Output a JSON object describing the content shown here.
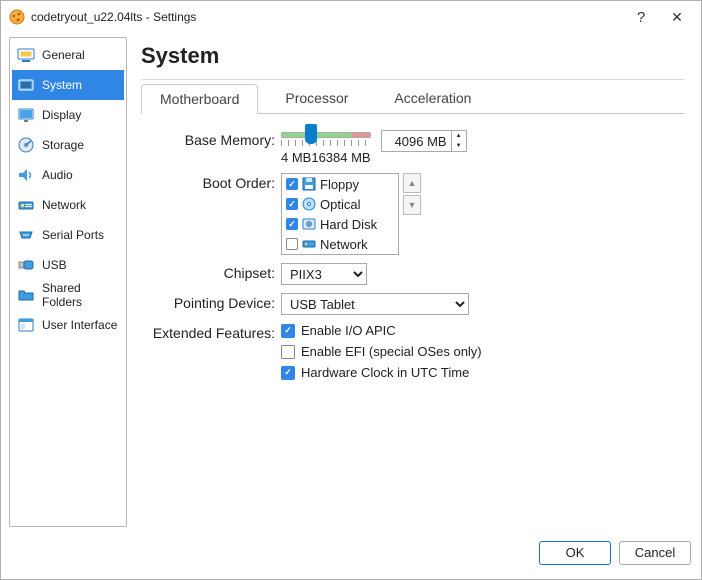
{
  "window": {
    "title": "codetryout_u22.04lts - Settings"
  },
  "sidebar": {
    "items": [
      {
        "label": "General"
      },
      {
        "label": "System"
      },
      {
        "label": "Display"
      },
      {
        "label": "Storage"
      },
      {
        "label": "Audio"
      },
      {
        "label": "Network"
      },
      {
        "label": "Serial Ports"
      },
      {
        "label": "USB"
      },
      {
        "label": "Shared Folders"
      },
      {
        "label": "User Interface"
      }
    ],
    "selected_index": 1
  },
  "page": {
    "title": "System"
  },
  "tabs": {
    "items": [
      "Motherboard",
      "Processor",
      "Acceleration"
    ],
    "active_index": 0
  },
  "memory": {
    "label": "Base Memory:",
    "value": "4096 MB",
    "min_label": "4 MB",
    "max_label": "16384 MB"
  },
  "boot": {
    "label": "Boot Order:",
    "items": [
      {
        "checked": true,
        "label": "Floppy"
      },
      {
        "checked": true,
        "label": "Optical"
      },
      {
        "checked": true,
        "label": "Hard Disk"
      },
      {
        "checked": false,
        "label": "Network"
      }
    ]
  },
  "chipset": {
    "label": "Chipset:",
    "value": "PIIX3"
  },
  "pointing": {
    "label": "Pointing Device:",
    "value": "USB Tablet"
  },
  "extended": {
    "label": "Extended Features:",
    "items": [
      {
        "checked": true,
        "label": "Enable I/O APIC"
      },
      {
        "checked": false,
        "label": "Enable EFI (special OSes only)"
      },
      {
        "checked": true,
        "label": "Hardware Clock in UTC Time"
      }
    ]
  },
  "footer": {
    "ok": "OK",
    "cancel": "Cancel"
  }
}
